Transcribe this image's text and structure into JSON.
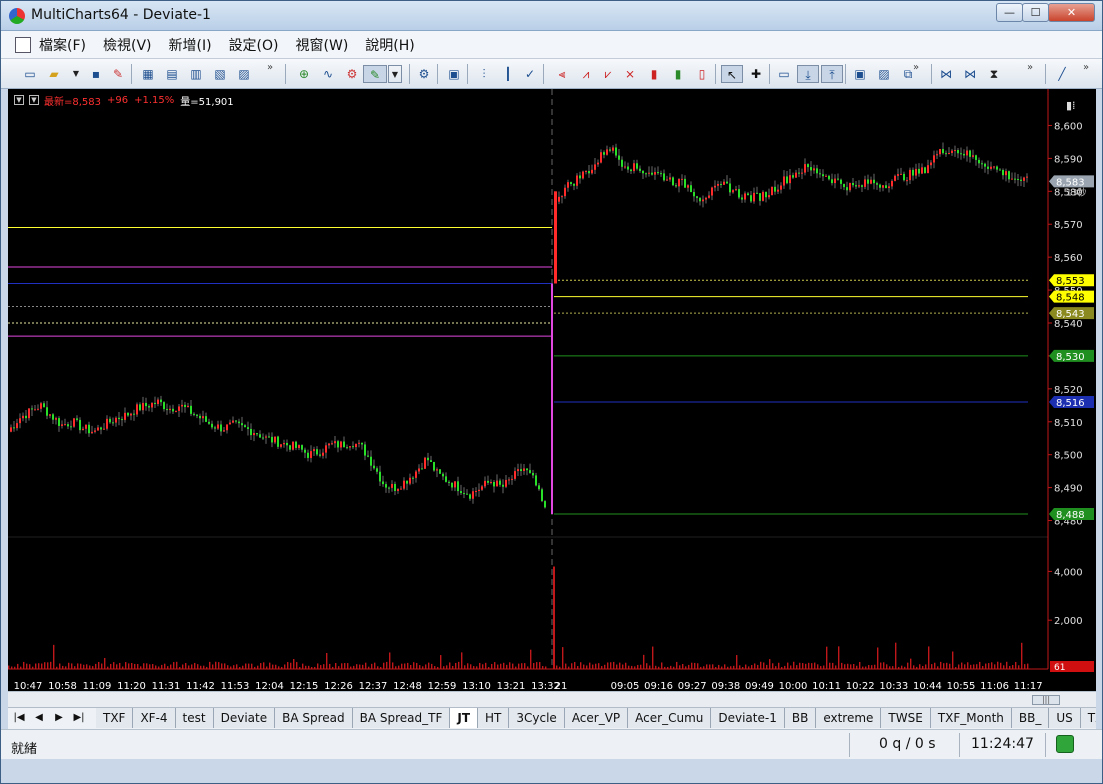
{
  "window": {
    "title": "MultiCharts64 - Deviate-1",
    "buttons": {
      "minimize": "—",
      "maximize": "☐",
      "close": "✕"
    }
  },
  "menu": {
    "items": [
      "檔案(F)",
      "檢視(V)",
      "新增(I)",
      "設定(O)",
      "視窗(W)",
      "說明(H)"
    ],
    "mdi_buttons": [
      "⇱",
      "—",
      "❐",
      "✕"
    ]
  },
  "toolbar": {
    "more": "»"
  },
  "legend": {
    "last": "最新=8,583",
    "change": "+96",
    "percent": "+1.15%",
    "volume": "量=51,901"
  },
  "chart_data": {
    "type": "candlestick",
    "price_axis": {
      "min": 8475,
      "max": 8605,
      "ticks": [
        "8,600",
        "8,590",
        "8,580",
        "8,570",
        "8,560",
        "8,550",
        "8,540",
        "8,530",
        "8,520",
        "8,510",
        "8,500",
        "8,490",
        "8,480"
      ]
    },
    "volume_axis": {
      "max": 5000,
      "ticks": [
        "4,000",
        "2,000"
      ],
      "last_volume_label": "61"
    },
    "time_axis": {
      "labels": [
        "10:47",
        "10:58",
        "11:09",
        "11:20",
        "11:31",
        "11:42",
        "11:53",
        "12:04",
        "12:15",
        "12:26",
        "12:37",
        "12:48",
        "12:59",
        "13:10",
        "13:21",
        "13:32",
        "21",
        "09:05",
        "09:16",
        "09:27",
        "09:38",
        "09:49",
        "10:00",
        "10:11",
        "10:22",
        "10:33",
        "10:44",
        "10:55",
        "11:06",
        "11:17"
      ]
    },
    "session_prices": {
      "day1": [
        8507,
        8511,
        8513,
        8515,
        8512,
        8509,
        8510,
        8508,
        8507,
        8509,
        8511,
        8512,
        8514,
        8515,
        8516,
        8514,
        8515,
        8513,
        8511,
        8509,
        8508,
        8509,
        8508,
        8507,
        8505,
        8504,
        8503,
        8502,
        8500,
        8501,
        8503,
        8503,
        8504,
        8502,
        8497,
        8491,
        8490,
        8492,
        8495,
        8499,
        8494,
        8492,
        8490,
        8488,
        8490,
        8492,
        8490,
        8493,
        8496,
        8492,
        8483
      ],
      "day2": [
        8578,
        8582,
        8585,
        8588,
        8594,
        8589,
        8587,
        8586,
        8585,
        8583,
        8582,
        8578,
        8580,
        8582,
        8579,
        8578,
        8579,
        8582,
        8585,
        8587,
        8586,
        8584,
        8582,
        8581,
        8583,
        8582,
        8584,
        8585,
        8586,
        8591,
        8593,
        8592,
        8590,
        8588,
        8586,
        8584,
        8583
      ]
    },
    "price_labels": [
      {
        "text": "8,583",
        "color": "#9aa5b1"
      },
      {
        "text": "13秒",
        "color": "#c8c8c8"
      },
      {
        "text": "8,553",
        "color": "#ffff00"
      },
      {
        "text": "8,548",
        "color": "#ffff00"
      },
      {
        "text": "8,543",
        "color": "#8a8a20"
      },
      {
        "text": "8,530",
        "color": "#1f8f1f"
      },
      {
        "text": "8,516",
        "color": "#1b2fb0"
      },
      {
        "text": "8,488",
        "color": "#1f8f1f"
      }
    ],
    "levels_day1": [
      8569,
      8557,
      8552,
      8545,
      8540,
      8536
    ],
    "levels_day2": [
      8553,
      8548,
      8543,
      8530,
      8516,
      8482
    ],
    "colors": {
      "up": "#ff2a2a",
      "down": "#28e028",
      "volume": "#c0181a",
      "magenta": "#e048e0",
      "yellow": "#ffff30",
      "blue": "#2030c0",
      "green": "#1f8f1f"
    }
  },
  "tabs": {
    "nav": [
      "|◀",
      "◀",
      "▶",
      "▶|"
    ],
    "items": [
      "TXF",
      "XF-4",
      "test",
      "Deviate",
      "BA Spread",
      "BA Spread_TF",
      "JT",
      "HT",
      "3Cycle",
      "Acer_VP",
      "Acer_Cumu",
      "Deviate-1",
      "BB",
      "extreme",
      "TWSE",
      "TXF_Month",
      "BB_",
      "US",
      "TXF"
    ],
    "active_index": 6
  },
  "status": {
    "text": "就緒",
    "queue": "0 q / 0 s",
    "clock": "11:24:47"
  }
}
